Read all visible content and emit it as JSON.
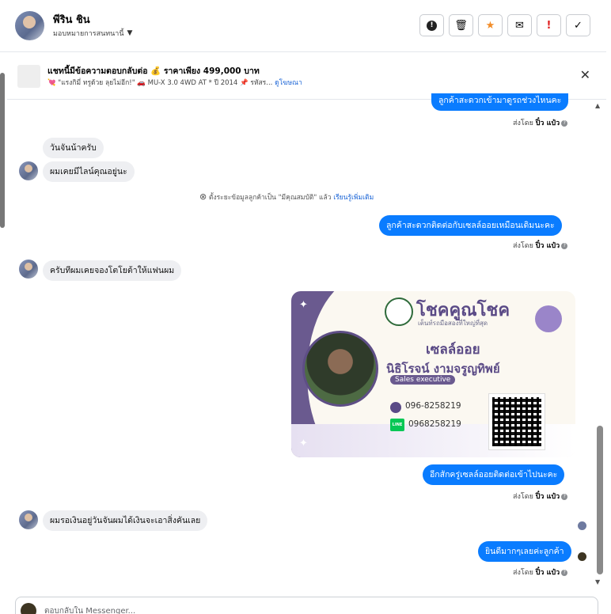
{
  "header": {
    "contact_name": "พีริน ชิน",
    "assign_label": "มอบหมายการสนทนานี้",
    "actions": [
      "!",
      "🗑",
      "★",
      "✉",
      "!",
      "✓"
    ]
  },
  "banner": {
    "title": "แชทนี้มีข้อความตอบกลับต่อ 💰 ราคาเพียง 499,000 บาท",
    "subtitle": "💘 \"แรงกิมี่ ทรูด้วย ลุยไม่อีก!\" 🚗 MU-X 3.0 4WD AT * ปี 2014 📌 รหัสร...",
    "link": "ดูโฆษณา",
    "close": "✕"
  },
  "messages": {
    "m1_out": "ลูกค้าสะดวกเข้ามาดูรถช่วงไหนคะ",
    "sent1": "ส่งโดย",
    "sender": "ปิ๋ว แป๋ว",
    "m2_in": "วันจันน้าครับ",
    "m3_in": "ผมเคยมีไลน์คุณอยู่นะ",
    "system": "ตั้งระยะข้อมูลลูกค้าเป็น \"มีคุณสมบัติ\" แล้ว",
    "system_link": "เรียนรู้เพิ่มเติม",
    "m4_out": "ลูกค้าสะดวกติดต่อกับเซลล์ออยเหมือนเดิมนะคะ",
    "m5_in": "ครับทีผมเคยจองโตโยต้าให้แฟนผม",
    "m6_out": "อีกสักครู่เซลล์ออยติดต่อเข้าไปนะคะ",
    "m7_in": "ผมรอเงินอยู่วันจันผมได้เงินจะเอาสิ่งคันเลย",
    "m8_out": "ยินดีมากๆเลยค่ะลูกค้า"
  },
  "card": {
    "brand": "โชคคูณโชค",
    "tagline": "เต็นท์รถมือสองที่ใหญ่ที่สุด",
    "role": "เซลล์ออย",
    "name": "นิธิโรจน์  งามจรูญทิพย์",
    "title": "Sales executive",
    "phone": "096-8258219",
    "line_label": "LINE",
    "line_id": "0968258219"
  },
  "composer": {
    "placeholder": "ตอบกลับใน Messenger..."
  }
}
